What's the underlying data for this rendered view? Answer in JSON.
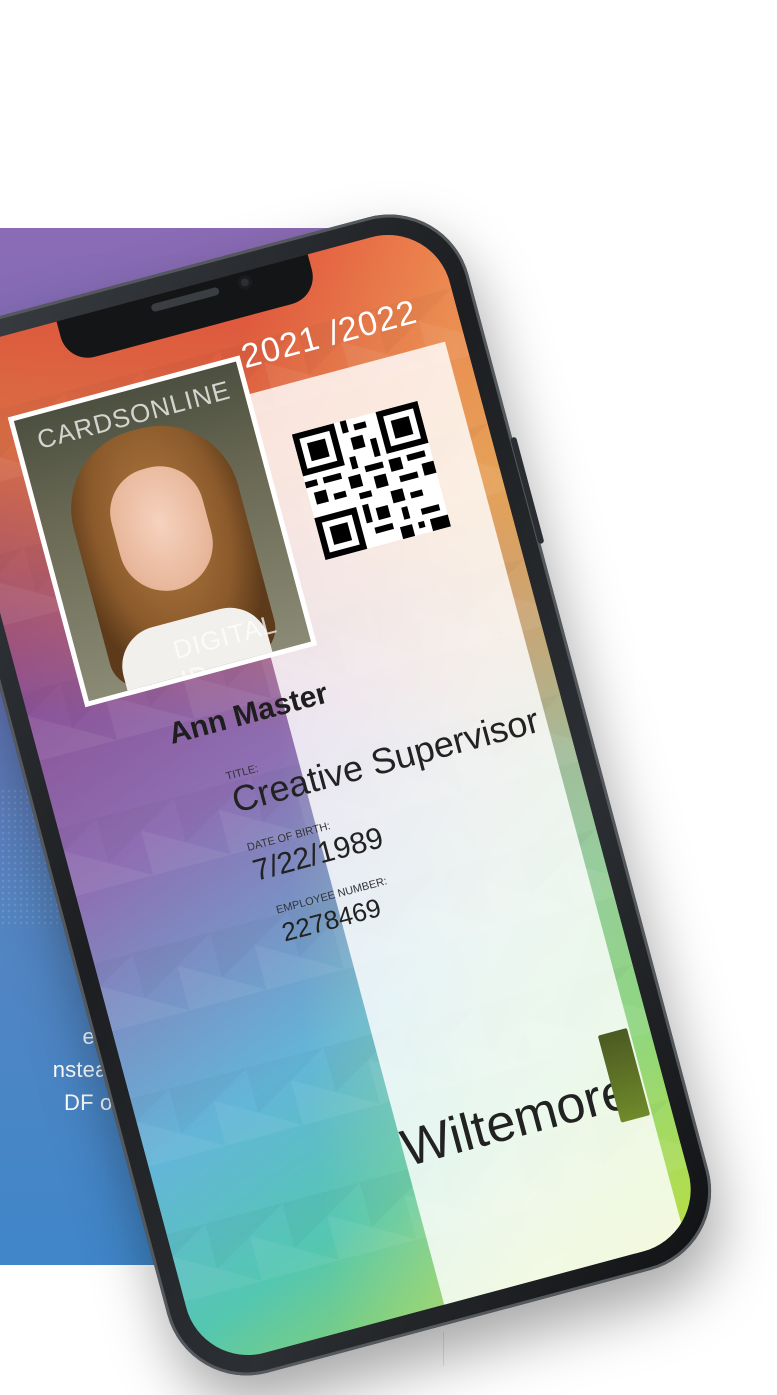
{
  "background_text": "e to\nnstead\nDF or",
  "card": {
    "year": "2021 /2022",
    "watermark_top": "CARDSONLINE",
    "watermark_bottom": "DIGITAL ID",
    "name": "Ann Master",
    "title_label": "TITLE:",
    "title_value": "Creative Supervisor",
    "dob_label": "DATE OF BIRTH:",
    "dob_value": "7/22/1989",
    "employee_label": "EMPLOYEE NUMBER:",
    "employee_value": "2278469",
    "company": "Wiltemore"
  },
  "colors": {
    "panel_top": "#8b6bb5",
    "panel_bottom": "#3f86c9",
    "card_red": "#e84833",
    "card_green": "#a8d648"
  },
  "icons": [
    "qr-code-icon",
    "company-logo-icon"
  ]
}
